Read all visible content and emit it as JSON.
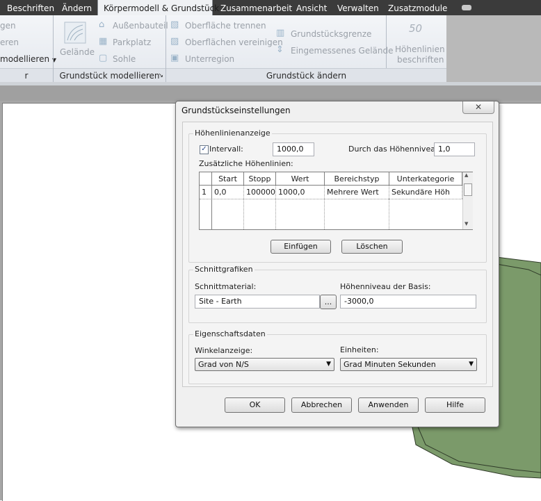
{
  "ribbon": {
    "tabs": [
      {
        "label": "Beschriften",
        "active": false
      },
      {
        "label": "Ändern",
        "active": false
      },
      {
        "label": "Körpermodell & Grundstück",
        "active": true
      },
      {
        "label": "Zusammenarbeit",
        "active": false
      },
      {
        "label": "Ansicht",
        "active": false
      },
      {
        "label": "Verwalten",
        "active": false
      },
      {
        "label": "Zusatzmodule",
        "active": false
      }
    ],
    "left_items": [
      "gen",
      "eren",
      "modellieren"
    ],
    "gelaende": "Gelände",
    "model_items": [
      "Außenbauteil",
      "Parkplatz",
      "Sohle"
    ],
    "edit_items": [
      "Oberfläche trennen",
      "Oberflächen vereinigen",
      "Unterregion"
    ],
    "edit_items2": [
      "Grundstücksgrenze",
      "Eingemessenes Gelände"
    ],
    "contour_label_number": "50",
    "contour_label": [
      "Höhenlinien",
      "beschriften"
    ],
    "panels": {
      "model": "Grundstück modellieren",
      "edit": "Grundstück ändern",
      "left_stub": "r"
    }
  },
  "dialog": {
    "title": "Grundstückseinstellungen",
    "close": "✕",
    "contours": {
      "group_title": "Höhenlinienanzeige",
      "interval_label": "Intervall:",
      "interval_checked": true,
      "interval_value": "1000,0",
      "pass_label": "Durch das Höhenniveau:",
      "pass_value": "1,0",
      "additional_label": "Zusätzliche Höhenlinien:",
      "columns": [
        "Start",
        "Stopp",
        "Wert",
        "Bereichstyp",
        "Unterkategorie"
      ],
      "rows": [
        {
          "index": "1",
          "start": "0,0",
          "stop": "100000",
          "value": "1000,0",
          "range_type": "Mehrere Wert",
          "subcategory": "Sekundäre Höh"
        }
      ],
      "insert_button": "Einfügen",
      "delete_button": "Löschen"
    },
    "section": {
      "group_title": "Schnittgrafiken",
      "material_label": "Schnittmaterial:",
      "material_value": "Site - Earth",
      "browse_button": "...",
      "base_label": "Höhenniveau der Basis:",
      "base_value": "-3000,0"
    },
    "properties": {
      "group_title": "Eigenschaftsdaten",
      "angle_label": "Winkelanzeige:",
      "angle_value": "Grad von N/S",
      "units_label": "Einheiten:",
      "units_value": "Grad Minuten Sekunden"
    },
    "buttons": {
      "ok": "OK",
      "cancel": "Abbrechen",
      "apply": "Anwenden",
      "help": "Hilfe"
    }
  },
  "colors": {
    "tabbar": "#3b3b3b",
    "toposurface": "#7b9a6a",
    "dialog_bg": "#f0f0f0"
  }
}
